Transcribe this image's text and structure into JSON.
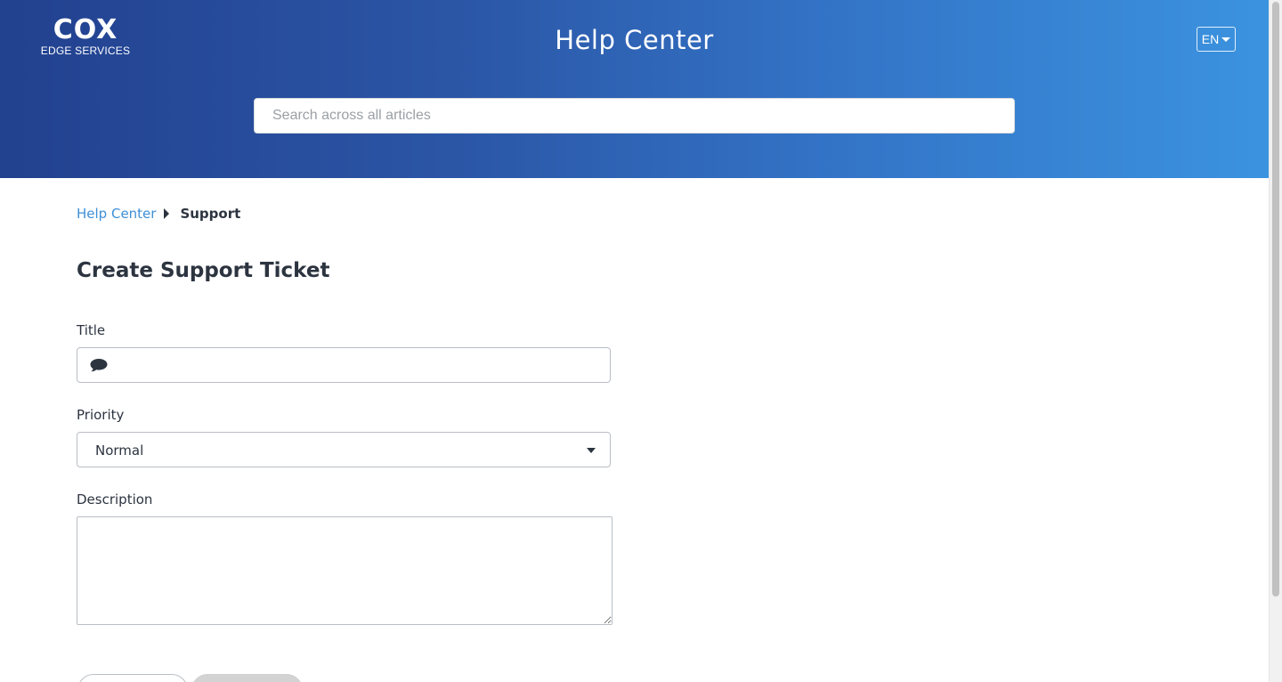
{
  "header": {
    "logo": {
      "mark": "COX",
      "subtitle": "EDGE SERVICES"
    },
    "title": "Help Center",
    "language": {
      "selected": "EN"
    },
    "search": {
      "placeholder": "Search across all articles",
      "value": ""
    }
  },
  "breadcrumb": {
    "items": [
      {
        "label": "Help Center"
      },
      {
        "label": "Support"
      }
    ]
  },
  "form": {
    "heading": "Create Support Ticket",
    "title_field": {
      "label": "Title",
      "value": "",
      "icon": "chat-bubble-icon"
    },
    "priority_field": {
      "label": "Priority",
      "selected": "Normal"
    },
    "description_field": {
      "label": "Description",
      "value": ""
    }
  },
  "colors": {
    "gradient_start": "#22418f",
    "gradient_end": "#3b93df",
    "link": "#3d8fd6",
    "text": "#2c3440"
  }
}
